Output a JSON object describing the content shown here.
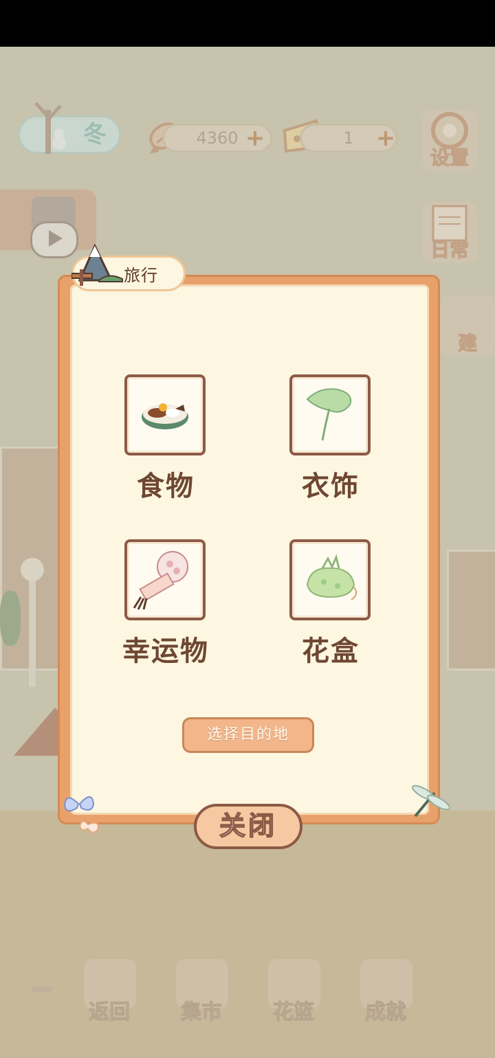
{
  "status_bar": {},
  "hud": {
    "season_label": "冬",
    "fish_count": "4360",
    "cheese_count": "1",
    "settings_label": "设置",
    "daily_label": "日常",
    "build_label": "建"
  },
  "dialog": {
    "title": "旅行",
    "categories": [
      {
        "label": "食物",
        "icon": "food-bowl-icon"
      },
      {
        "label": "衣饰",
        "icon": "lotus-leaf-icon"
      },
      {
        "label": "幸运物",
        "icon": "lucky-fan-icon"
      },
      {
        "label": "花盒",
        "icon": "flower-bundle-icon"
      }
    ],
    "select_destination": "选择目的地",
    "close": "关闭"
  },
  "bottom_nav": [
    {
      "label": "返回"
    },
    {
      "label": "集市"
    },
    {
      "label": "花篮"
    },
    {
      "label": "成就"
    }
  ],
  "colors": {
    "frame": "#e9a16b",
    "paper": "#fdf6e0",
    "text_brown": "#6e4733",
    "button_orange": "#f2b68a"
  }
}
